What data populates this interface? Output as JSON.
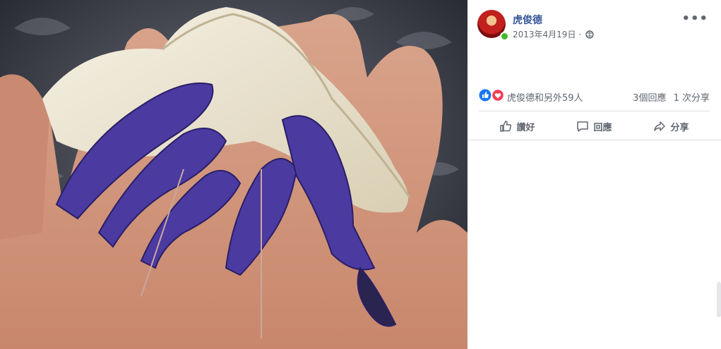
{
  "post": {
    "author": "虎俊德",
    "date": "2013年4月19日",
    "date_separator": "·",
    "privacy_icon": "globe-icon",
    "more_label": "•••"
  },
  "reactions": {
    "icons": [
      "like-icon",
      "love-icon"
    ],
    "summary": "虎俊德和另外59人",
    "comments": "3個回應",
    "shares": "1 次分享"
  },
  "actions": [
    {
      "label": "讚好",
      "icon": "thumbs-up-icon"
    },
    {
      "label": "回應",
      "icon": "comment-icon"
    },
    {
      "label": "分享",
      "icon": "share-icon"
    }
  ],
  "colors": {
    "link": "#385898",
    "muted": "#606770",
    "like": "#1877f2",
    "love": "#f33e58",
    "online": "#42b72a"
  }
}
